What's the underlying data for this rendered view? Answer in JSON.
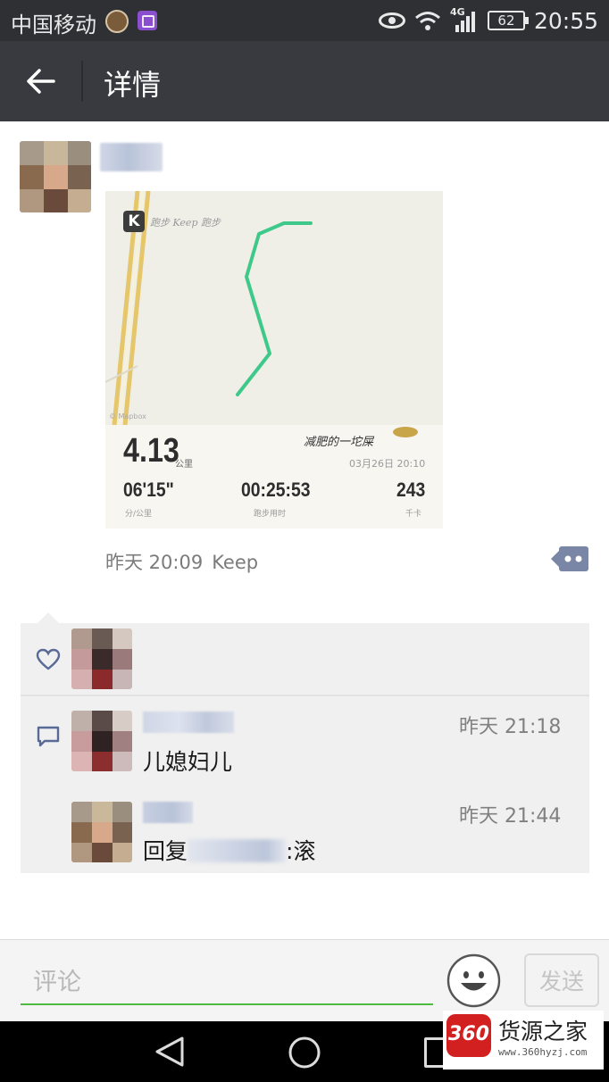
{
  "status_bar": {
    "carrier": "中国移动",
    "network": "4G",
    "battery": "62",
    "time": "20:55"
  },
  "header": {
    "title": "详情"
  },
  "post": {
    "workout_card": {
      "app_badge": "K",
      "note": "跑步 Keep 跑步",
      "distance": "4.13",
      "distance_unit": "公里",
      "signature": "减肥的一坨屎",
      "date": "03月26日 20:10",
      "pace": "06'15\"",
      "pace_label": "分/公里",
      "duration": "00:25:53",
      "duration_label": "跑步用时",
      "calories": "243",
      "calories_label": "千卡",
      "map_attribution": "© Mapbox",
      "route_color": "#3ec98a"
    },
    "time": "昨天 20:09",
    "source": "Keep"
  },
  "comments": [
    {
      "time": "昨天 21:18",
      "text": "儿媳妇儿"
    },
    {
      "time": "昨天 21:44",
      "reply_prefix": "回复",
      "reply_suffix": ":滚"
    }
  ],
  "comment_bar": {
    "placeholder": "评论",
    "send_label": "发送",
    "accent_color": "#4bbc3f"
  },
  "watermark": {
    "badge": "360",
    "text": "货源之家",
    "url": "www.360hyzj.com"
  }
}
